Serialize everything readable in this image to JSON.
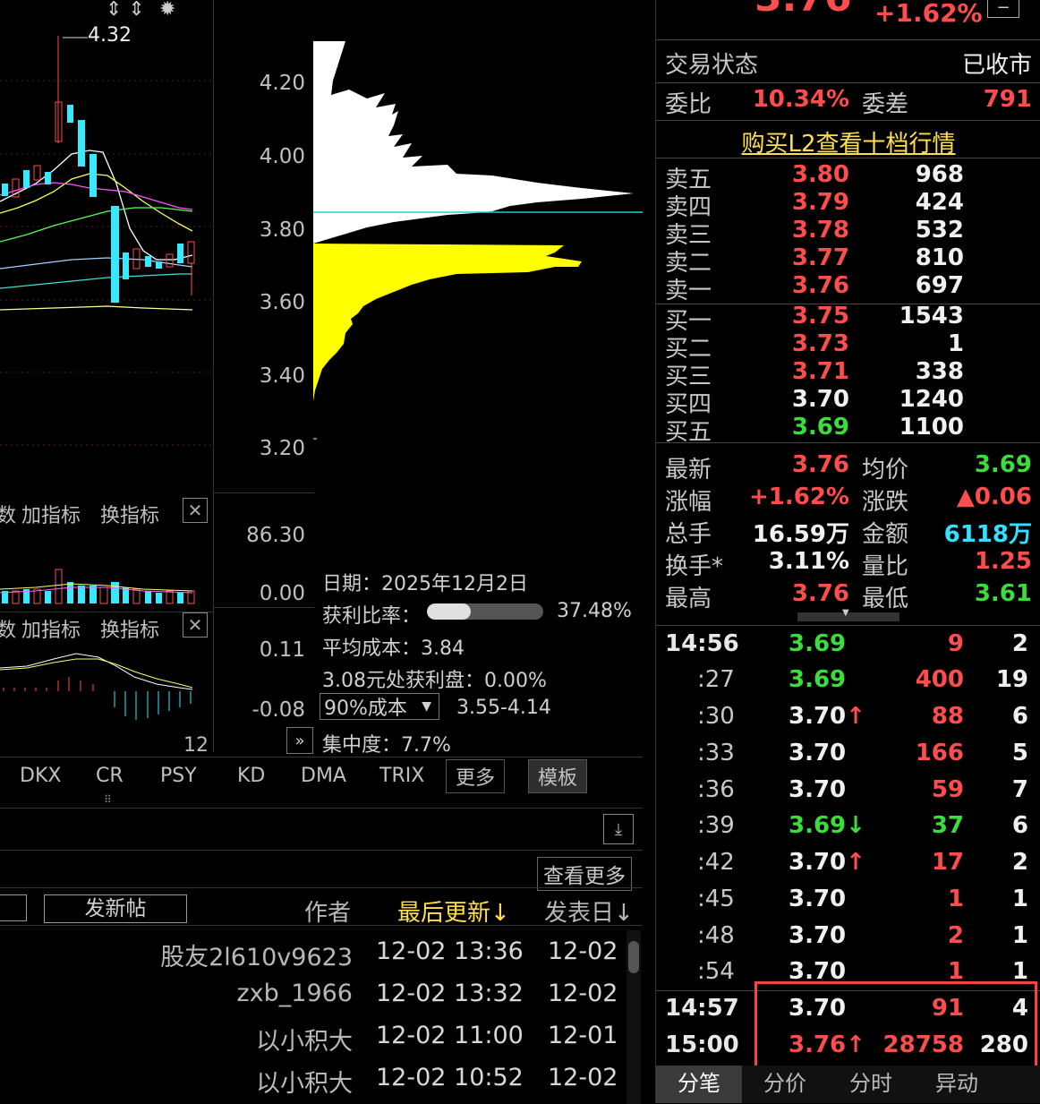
{
  "kline": {
    "high_marker": "4.32",
    "x_label": "12"
  },
  "price_axis": {
    "ticks": [
      "4.20",
      "4.00",
      "3.80",
      "3.60",
      "3.40",
      "3.20"
    ],
    "vol_top": "86.30",
    "vol_bottom": "0.00",
    "macd_top": "0.11",
    "macd_bottom": "-0.08"
  },
  "indicator_bar_1": {
    "partial": "数",
    "add": "加指标",
    "swap": "换指标"
  },
  "indicator_bar_2": {
    "partial": "数",
    "add": "加指标",
    "swap": "换指标"
  },
  "chip_info": {
    "date_label": "日期：",
    "date": "2025年12月2日",
    "profit_label": "获利比率：",
    "profit_value": "37.48%",
    "profit_fraction": 0.3748,
    "avg_cost_label": "平均成本：",
    "avg_cost": "3.84",
    "profit_at_label": "3.08元处获利盘：",
    "profit_at_value": "0.00%",
    "cost_select": "90%成本",
    "cost_range": "3.55-4.14",
    "concentration_label": "集中度：",
    "concentration": "7.7%"
  },
  "tabs": {
    "items": [
      "DKX",
      "CR",
      "PSY",
      "KD",
      "DMA",
      "TRIX"
    ],
    "more": "更多",
    "template": "模板"
  },
  "forum": {
    "see_more": "查看更多",
    "new_post": "发新帖",
    "col_author": "作者",
    "col_updated": "最后更新↓",
    "col_posted": "发表日↓",
    "rows": [
      {
        "author": "股友2l610v9623",
        "updated": "12-02 13:36",
        "posted": "12-02"
      },
      {
        "author": "zxb_1966",
        "updated": "12-02 13:32",
        "posted": "12-02"
      },
      {
        "author": "以小积大",
        "updated": "12-02 11:00",
        "posted": "12-01"
      },
      {
        "author": "以小积大",
        "updated": "12-02 10:52",
        "posted": "12-02"
      }
    ]
  },
  "quote": {
    "price_partial": "3.76",
    "change_pct_top": "+1.62%",
    "status_label": "交易状态",
    "status_value": "已收市",
    "weibi_label": "委比",
    "weibi_value": "10.34%",
    "weicha_label": "委差",
    "weicha_value": "791",
    "l2_link": "购买L2查看十档行情",
    "asks": [
      {
        "label": "卖五",
        "price": "3.80",
        "vol": "968"
      },
      {
        "label": "卖四",
        "price": "3.79",
        "vol": "424"
      },
      {
        "label": "卖三",
        "price": "3.78",
        "vol": "532"
      },
      {
        "label": "卖二",
        "price": "3.77",
        "vol": "810"
      },
      {
        "label": "卖一",
        "price": "3.76",
        "vol": "697"
      }
    ],
    "bids": [
      {
        "label": "买一",
        "price": "3.75",
        "vol": "1543"
      },
      {
        "label": "买二",
        "price": "3.73",
        "vol": "1"
      },
      {
        "label": "买三",
        "price": "3.71",
        "vol": "338"
      },
      {
        "label": "买四",
        "price": "3.70",
        "vol": "1240"
      },
      {
        "label": "买五",
        "price": "3.69",
        "vol": "1100"
      }
    ],
    "stats": {
      "latest_label": "最新",
      "latest": "3.76",
      "avg_label": "均价",
      "avg": "3.69",
      "chg_pct_label": "涨幅",
      "chg_pct": "+1.62%",
      "chg_label": "涨跌",
      "chg": "▲0.06",
      "volume_label": "总手",
      "volume": "16.59万",
      "amount_label": "金额",
      "amount": "6118万",
      "turnover_label": "换手*",
      "turnover": "3.11%",
      "vol_ratio_label": "量比",
      "vol_ratio": "1.25",
      "high_label": "最高",
      "high": "3.76",
      "low_label": "最低",
      "low": "3.61"
    }
  },
  "ticks": [
    {
      "time": "14:56",
      "price": "3.69",
      "pc": "green",
      "arrow": "",
      "vol": "9",
      "vc": "red",
      "n": "2",
      "bold_time": true
    },
    {
      "time": ":27",
      "price": "3.69",
      "pc": "green",
      "arrow": "",
      "vol": "400",
      "vc": "red",
      "n": "19",
      "bold_time": false
    },
    {
      "time": ":30",
      "price": "3.70",
      "pc": "white",
      "arrow": "up",
      "vol": "88",
      "vc": "red",
      "n": "6",
      "bold_time": false
    },
    {
      "time": ":33",
      "price": "3.70",
      "pc": "white",
      "arrow": "",
      "vol": "166",
      "vc": "red",
      "n": "5",
      "bold_time": false
    },
    {
      "time": ":36",
      "price": "3.70",
      "pc": "white",
      "arrow": "",
      "vol": "59",
      "vc": "red",
      "n": "7",
      "bold_time": false
    },
    {
      "time": ":39",
      "price": "3.69",
      "pc": "green",
      "arrow": "down",
      "vol": "37",
      "vc": "green",
      "n": "6",
      "bold_time": false
    },
    {
      "time": ":42",
      "price": "3.70",
      "pc": "white",
      "arrow": "up",
      "vol": "17",
      "vc": "red",
      "n": "2",
      "bold_time": false
    },
    {
      "time": ":45",
      "price": "3.70",
      "pc": "white",
      "arrow": "",
      "vol": "1",
      "vc": "red",
      "n": "1",
      "bold_time": false
    },
    {
      "time": ":48",
      "price": "3.70",
      "pc": "white",
      "arrow": "",
      "vol": "2",
      "vc": "red",
      "n": "1",
      "bold_time": false
    },
    {
      "time": ":54",
      "price": "3.70",
      "pc": "white",
      "arrow": "",
      "vol": "1",
      "vc": "red",
      "n": "1",
      "bold_time": false
    },
    {
      "time": "14:57",
      "price": "3.70",
      "pc": "white",
      "arrow": "",
      "vol": "91",
      "vc": "red",
      "n": "4",
      "bold_time": true
    },
    {
      "time": "15:00",
      "price": "3.76",
      "pc": "red",
      "arrow": "up",
      "vol": "28758",
      "vc": "red",
      "n": "280",
      "bold_time": true
    }
  ],
  "bottom_tabs": [
    "分笔",
    "分价",
    "分时",
    "异动"
  ],
  "colors": {
    "up": "#ff4d4d",
    "down": "#3ddc3d",
    "highlight_box": "#ff4040",
    "chip_profit": "#ffff00",
    "chip_loss": "#ffffff"
  }
}
